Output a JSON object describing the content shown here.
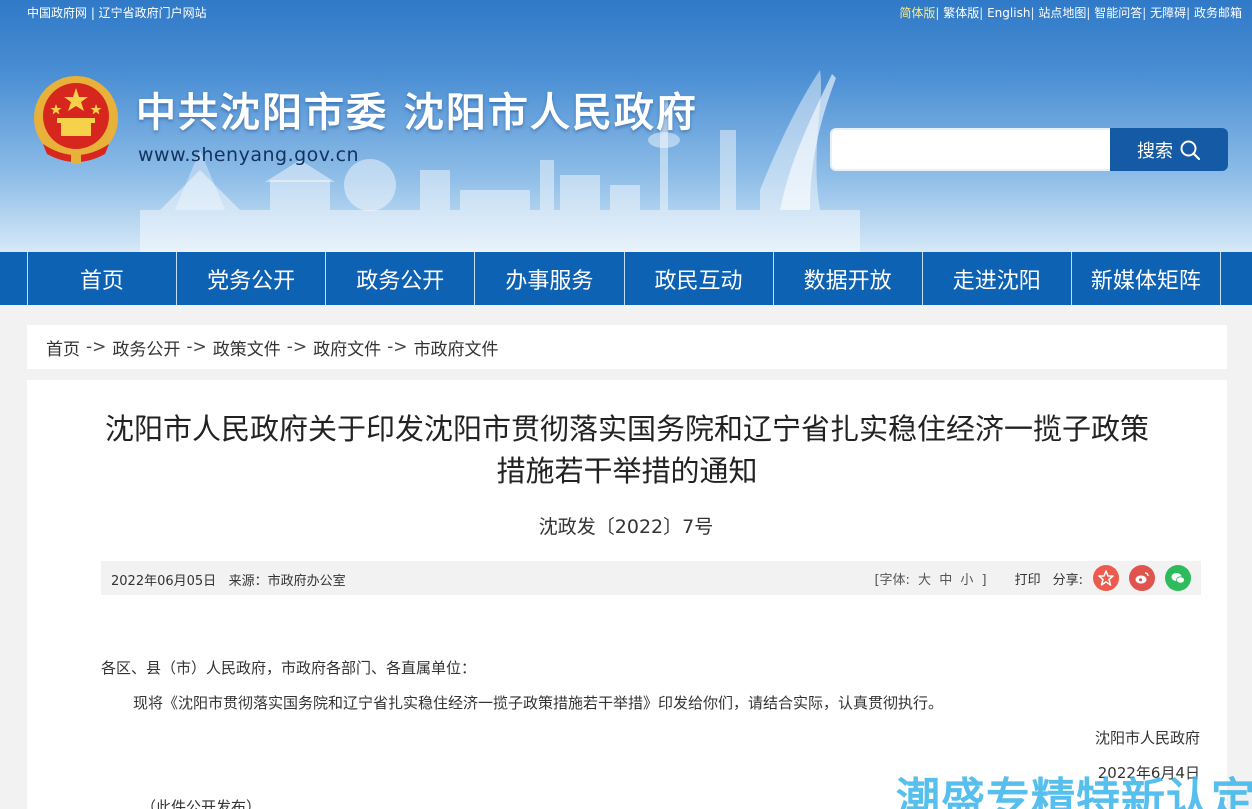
{
  "topbar": {
    "left": "中国政府网 | 辽宁省政府门户网站",
    "links": [
      "简体版",
      "繁体版",
      "English",
      "站点地图",
      "智能问答",
      "无障碍",
      "政务邮箱"
    ]
  },
  "header": {
    "title": "中共沈阳市委  沈阳市人民政府",
    "url": "www.shenyang.gov.cn",
    "search_placeholder": "",
    "search_button": "搜索"
  },
  "nav": [
    "首页",
    "党务公开",
    "政务公开",
    "办事服务",
    "政民互动",
    "数据开放",
    "走进沈阳",
    "新媒体矩阵"
  ],
  "breadcrumb": [
    "首页",
    "政务公开",
    "政策文件",
    "政府文件",
    "市政府文件"
  ],
  "breadcrumb_sep": "->",
  "article": {
    "title_line1": "沈阳市人民政府关于印发沈阳市贯彻落实国务院和辽宁省扎实稳住经济一揽子政策",
    "title_line2": "措施若干举措的通知",
    "doc_number": "沈政发〔2022〕7号",
    "date": "2022年06月05日",
    "source": "来源：市政府办公室",
    "font_label": "[字体:",
    "font_sizes": [
      "大",
      "中",
      "小"
    ],
    "font_close": "]",
    "print": "打印",
    "share": "分享:",
    "para1": "各区、县（市）人民政府，市政府各部门、各直属单位：",
    "para2": "现将《沈阳市贯彻落实国务院和辽宁省扎实稳住经济一揽子政策措施若干举措》印发给你们，请结合实际，认真贯彻执行。",
    "signature": "沈阳市人民政府",
    "sign_date": "2022年6月4日",
    "note": "（此件公开发布）"
  },
  "colors": {
    "nav": "#0e62b4",
    "search_button": "#145aa4",
    "share_star": "#ec5b4d",
    "share_weibo": "#e0544d",
    "share_wechat": "#2dbb5d"
  },
  "watermark": "潮盛专精特新认定网"
}
